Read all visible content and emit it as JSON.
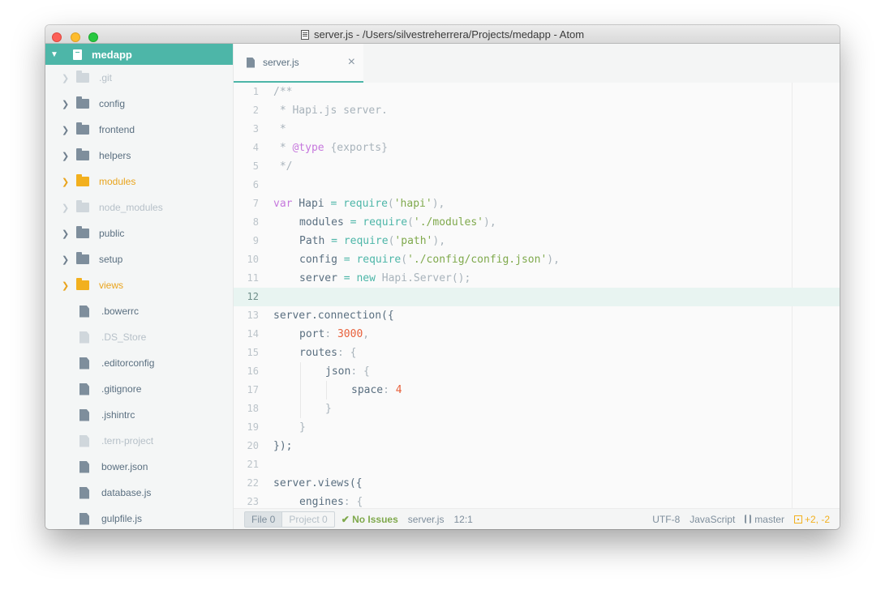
{
  "window": {
    "title": "server.js - /Users/silvestreherrera/Projects/medapp - Atom"
  },
  "sidebar": {
    "root": {
      "label": "medapp"
    },
    "items": [
      {
        "label": ".git",
        "type": "folder",
        "state": "dim"
      },
      {
        "label": "config",
        "type": "folder",
        "state": "normal"
      },
      {
        "label": "frontend",
        "type": "folder",
        "state": "normal"
      },
      {
        "label": "helpers",
        "type": "folder",
        "state": "normal"
      },
      {
        "label": "modules",
        "type": "folder",
        "state": "modified"
      },
      {
        "label": "node_modules",
        "type": "folder",
        "state": "dim"
      },
      {
        "label": "public",
        "type": "folder",
        "state": "normal"
      },
      {
        "label": "setup",
        "type": "folder",
        "state": "normal"
      },
      {
        "label": "views",
        "type": "folder",
        "state": "modified"
      },
      {
        "label": ".bowerrc",
        "type": "file",
        "state": "normal"
      },
      {
        "label": ".DS_Store",
        "type": "file",
        "state": "dim"
      },
      {
        "label": ".editorconfig",
        "type": "file",
        "state": "normal"
      },
      {
        "label": ".gitignore",
        "type": "file",
        "state": "normal"
      },
      {
        "label": ".jshintrc",
        "type": "file",
        "state": "normal"
      },
      {
        "label": ".tern-project",
        "type": "file",
        "state": "dim"
      },
      {
        "label": "bower.json",
        "type": "file",
        "state": "normal"
      },
      {
        "label": "database.js",
        "type": "file",
        "state": "normal"
      },
      {
        "label": "gulpfile.js",
        "type": "file",
        "state": "normal"
      }
    ]
  },
  "tab": {
    "label": "server.js",
    "close_glyph": "×"
  },
  "editor": {
    "lines": [
      {
        "n": "1",
        "indent": 0,
        "tokens": [
          [
            "c",
            "/**"
          ]
        ]
      },
      {
        "n": "2",
        "indent": 0,
        "tokens": [
          [
            "c",
            " * Hapi.js server."
          ]
        ]
      },
      {
        "n": "3",
        "indent": 0,
        "tokens": [
          [
            "c",
            " *"
          ]
        ]
      },
      {
        "n": "4",
        "indent": 0,
        "tokens": [
          [
            "c",
            " * "
          ],
          [
            "d",
            "@type"
          ],
          [
            "c",
            " {exports}"
          ]
        ]
      },
      {
        "n": "5",
        "indent": 0,
        "tokens": [
          [
            "c",
            " */"
          ]
        ]
      },
      {
        "n": "6",
        "indent": 0,
        "tokens": []
      },
      {
        "n": "7",
        "indent": 0,
        "tokens": [
          [
            "k",
            "var"
          ],
          [
            "v",
            " Hapi "
          ],
          [
            "o",
            "="
          ],
          [
            "v",
            " "
          ],
          [
            "o",
            "require"
          ],
          [
            "p",
            "("
          ],
          [
            "s",
            "'hapi'"
          ],
          [
            "p",
            "),"
          ]
        ]
      },
      {
        "n": "8",
        "indent": 1,
        "tokens": [
          [
            "v",
            "modules "
          ],
          [
            "o",
            "="
          ],
          [
            "v",
            " "
          ],
          [
            "o",
            "require"
          ],
          [
            "p",
            "("
          ],
          [
            "s",
            "'./modules'"
          ],
          [
            "p",
            "),"
          ]
        ]
      },
      {
        "n": "9",
        "indent": 1,
        "tokens": [
          [
            "v",
            "Path "
          ],
          [
            "o",
            "="
          ],
          [
            "v",
            " "
          ],
          [
            "o",
            "require"
          ],
          [
            "p",
            "("
          ],
          [
            "s",
            "'path'"
          ],
          [
            "p",
            "),"
          ]
        ]
      },
      {
        "n": "10",
        "indent": 1,
        "tokens": [
          [
            "v",
            "config "
          ],
          [
            "o",
            "="
          ],
          [
            "v",
            " "
          ],
          [
            "o",
            "require"
          ],
          [
            "p",
            "("
          ],
          [
            "s",
            "'./config/config.json'"
          ],
          [
            "p",
            "),"
          ]
        ]
      },
      {
        "n": "11",
        "indent": 1,
        "tokens": [
          [
            "v",
            "server "
          ],
          [
            "o",
            "="
          ],
          [
            "v",
            " "
          ],
          [
            "o",
            "new"
          ],
          [
            "v",
            " "
          ],
          [
            "c",
            "Hapi.Server"
          ],
          [
            "p",
            "();"
          ]
        ]
      },
      {
        "n": "12",
        "indent": 0,
        "tokens": [],
        "current": true
      },
      {
        "n": "13",
        "indent": 0,
        "tokens": [
          [
            "v",
            "server.connection({"
          ]
        ]
      },
      {
        "n": "14",
        "indent": 1,
        "tokens": [
          [
            "v",
            "port"
          ],
          [
            "p",
            ": "
          ],
          [
            "n",
            "3000"
          ],
          [
            "p",
            ","
          ]
        ]
      },
      {
        "n": "15",
        "indent": 1,
        "tokens": [
          [
            "v",
            "routes"
          ],
          [
            "p",
            ": {"
          ]
        ]
      },
      {
        "n": "16",
        "indent": 2,
        "tokens": [
          [
            "v",
            "json"
          ],
          [
            "p",
            ": {"
          ]
        ]
      },
      {
        "n": "17",
        "indent": 3,
        "tokens": [
          [
            "v",
            "space"
          ],
          [
            "p",
            ": "
          ],
          [
            "n",
            "4"
          ]
        ]
      },
      {
        "n": "18",
        "indent": 2,
        "tokens": [
          [
            "p",
            "}"
          ]
        ]
      },
      {
        "n": "19",
        "indent": 1,
        "tokens": [
          [
            "p",
            "}"
          ]
        ]
      },
      {
        "n": "20",
        "indent": 0,
        "tokens": [
          [
            "v",
            "});"
          ]
        ]
      },
      {
        "n": "21",
        "indent": 0,
        "tokens": []
      },
      {
        "n": "22",
        "indent": 0,
        "tokens": [
          [
            "v",
            "server.views({"
          ]
        ]
      },
      {
        "n": "23",
        "indent": 1,
        "tokens": [
          [
            "v",
            "engines"
          ],
          [
            "p",
            ": {"
          ]
        ]
      }
    ]
  },
  "statusbar": {
    "file_btn": "File 0",
    "project_btn": "Project 0",
    "issues": "✔ No Issues",
    "filename": "server.js",
    "cursor": "12:1",
    "encoding": "UTF-8",
    "grammar": "JavaScript",
    "branch": "master",
    "git_diff": "+2, -2"
  }
}
